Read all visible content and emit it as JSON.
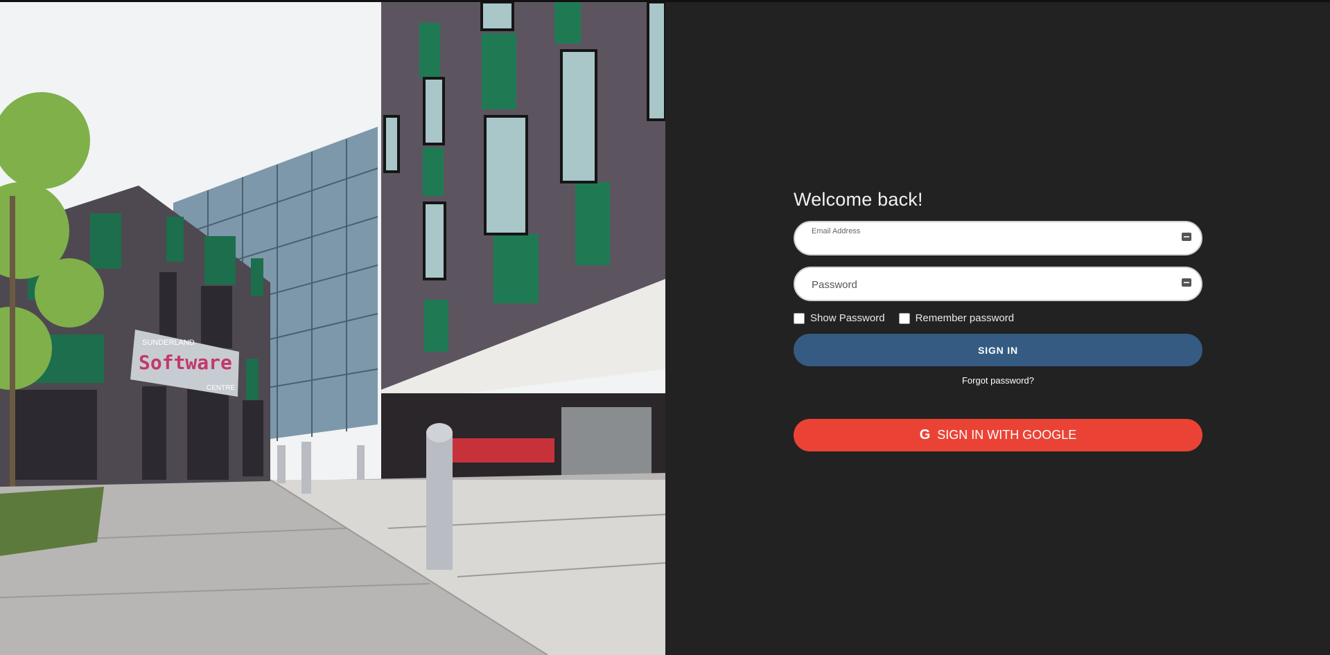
{
  "login": {
    "heading": "Welcome back!",
    "email": {
      "label": "Email Address",
      "placeholder": "",
      "value": ""
    },
    "password": {
      "placeholder": "Password",
      "value": ""
    },
    "show_password_label": "Show Password",
    "remember_password_label": "Remember password",
    "sign_in_label": "SIGN IN",
    "forgot_password_label": "Forgot password?",
    "google_sign_in_label": "SIGN IN WITH GOOGLE",
    "google_icon": "G"
  },
  "photo": {
    "sign_text_top": "SUNDERLAND",
    "sign_text_main": "Software",
    "sign_text_bottom": "CENTRE"
  },
  "colors": {
    "background": "#222222",
    "sign_in_button": "#355b82",
    "google_button": "#ea4335"
  }
}
